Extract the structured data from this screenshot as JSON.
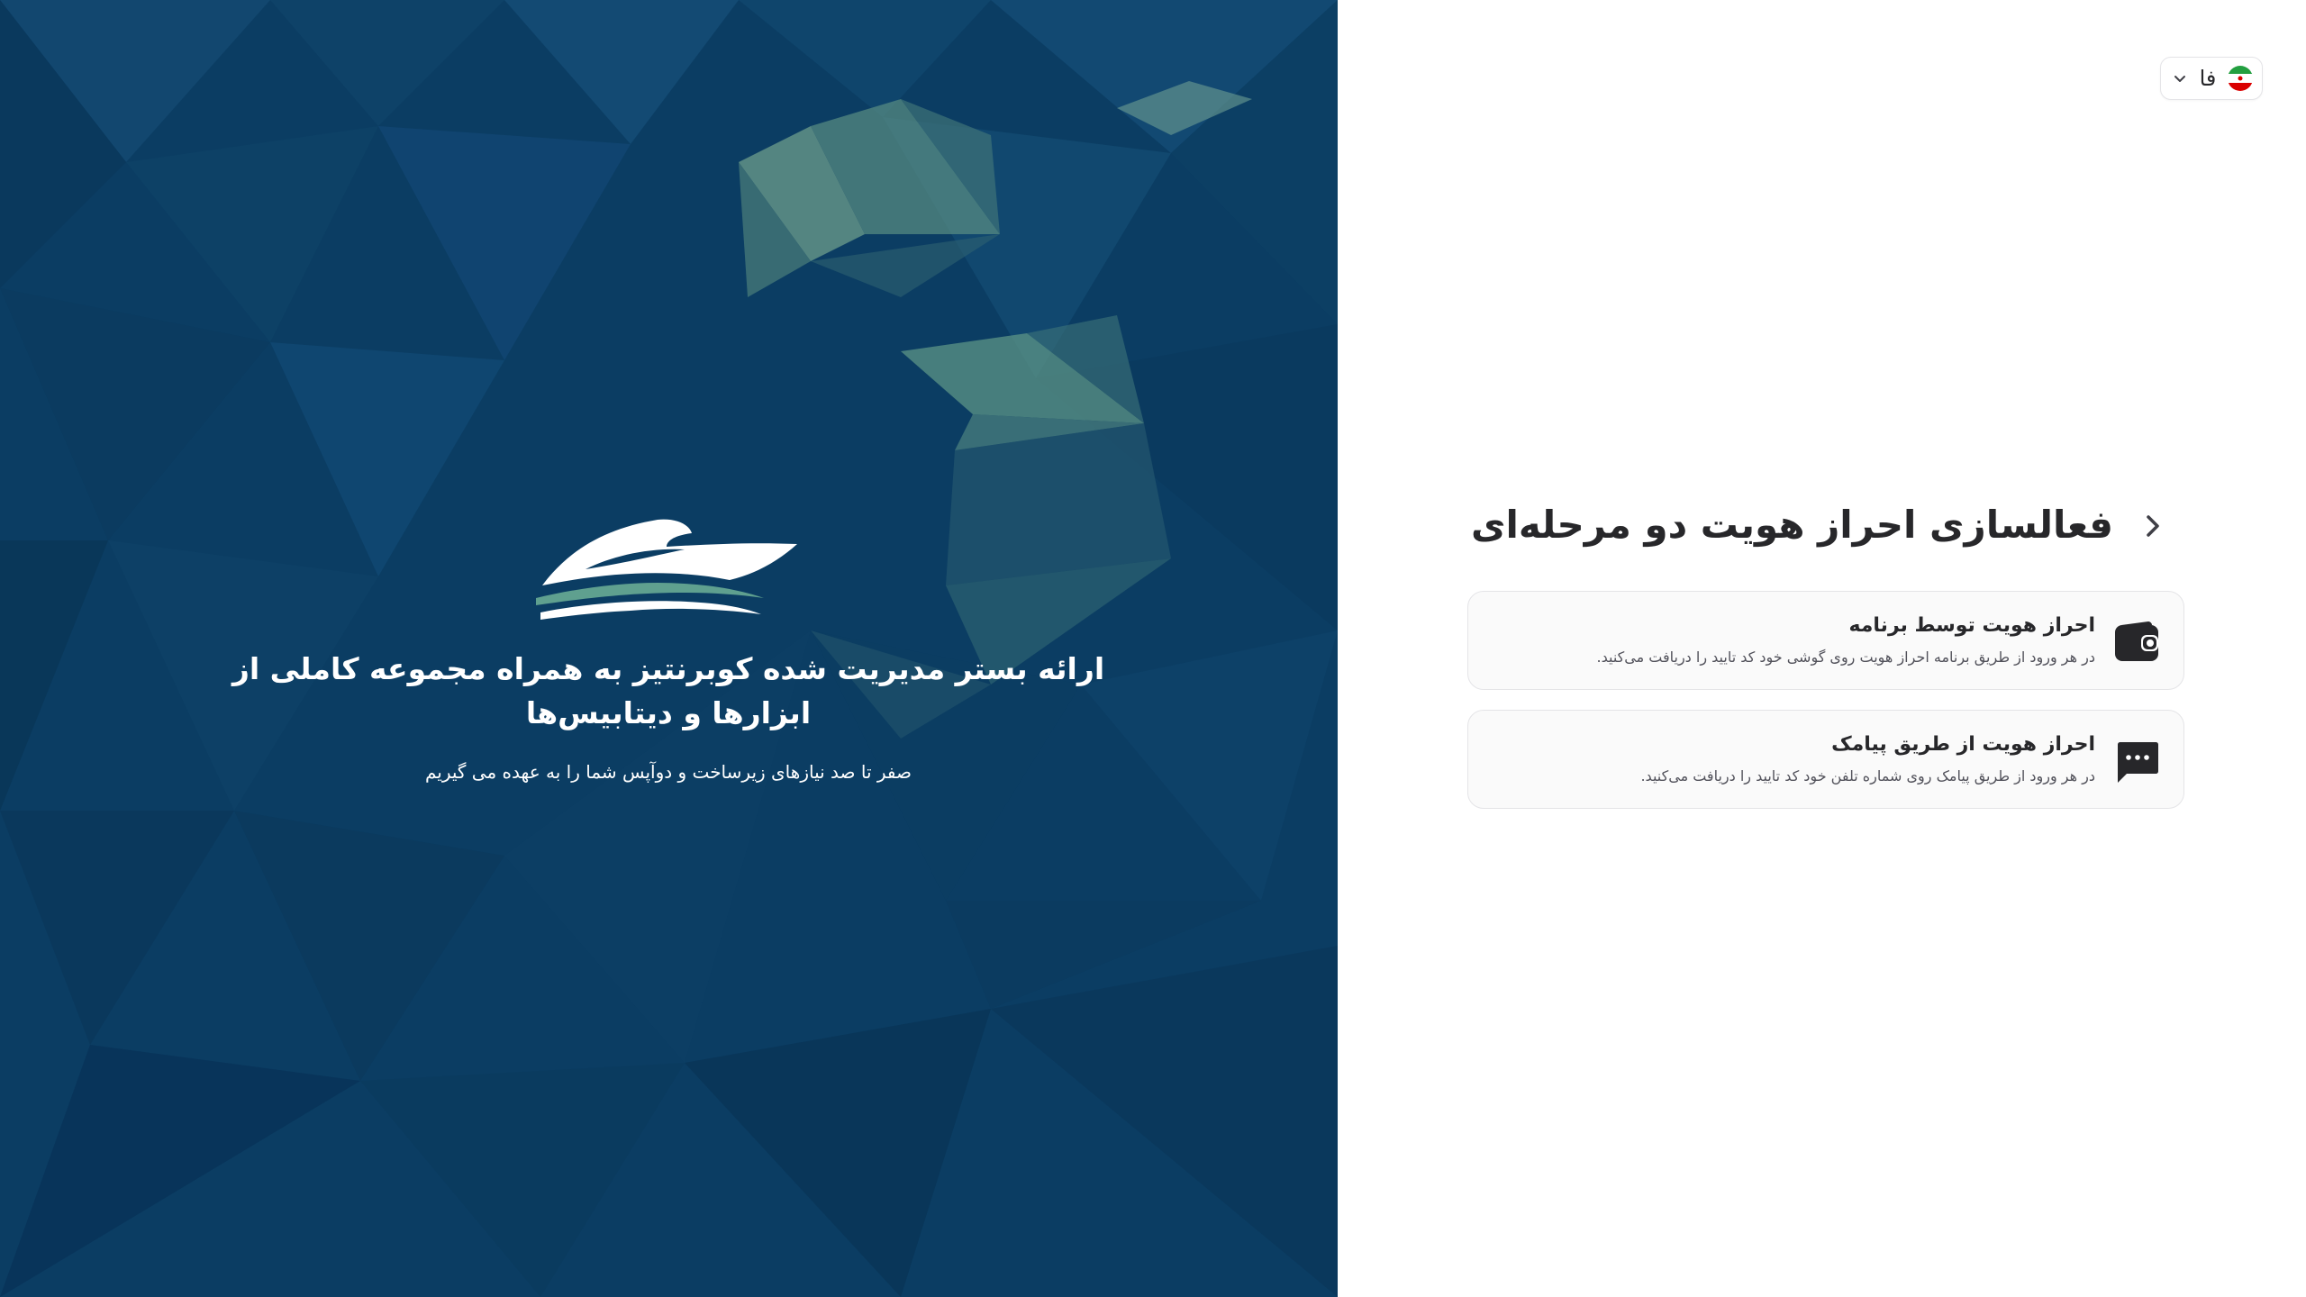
{
  "hero": {
    "title": "ارائه بستر مدیریت شده کوبرنتیز به همراه مجموعه کاملی از ابزارها و دیتابیس‌ها",
    "subtitle": "صفر تا صد نیازهای زیرساخت و دوآپس شما را به عهده می گیریم",
    "logo_icon": "boat-logo-icon",
    "colors": {
      "background": "#0b3d63",
      "accent": "#5a9a84"
    }
  },
  "language": {
    "selected": "فا",
    "flag_icon": "iran-flag-icon",
    "chevron_icon": "chevron-down-icon"
  },
  "page": {
    "title": "فعالسازی احراز هویت دو مرحله‌ای",
    "back_icon": "chevron-right-icon"
  },
  "options": [
    {
      "title": "احراز هویت توسط برنامه",
      "description": "در هر ورود از طریق برنامه احراز هویت روی گوشی خود کد تایید را دریافت می‌کنید.",
      "icon": "wallet-icon"
    },
    {
      "title": "احراز هویت از طریق پیامک",
      "description": "در هر ورود از طریق پیامک روی شماره تلفن خود کد تایید را دریافت می‌کنید.",
      "icon": "sms-message-icon"
    }
  ]
}
